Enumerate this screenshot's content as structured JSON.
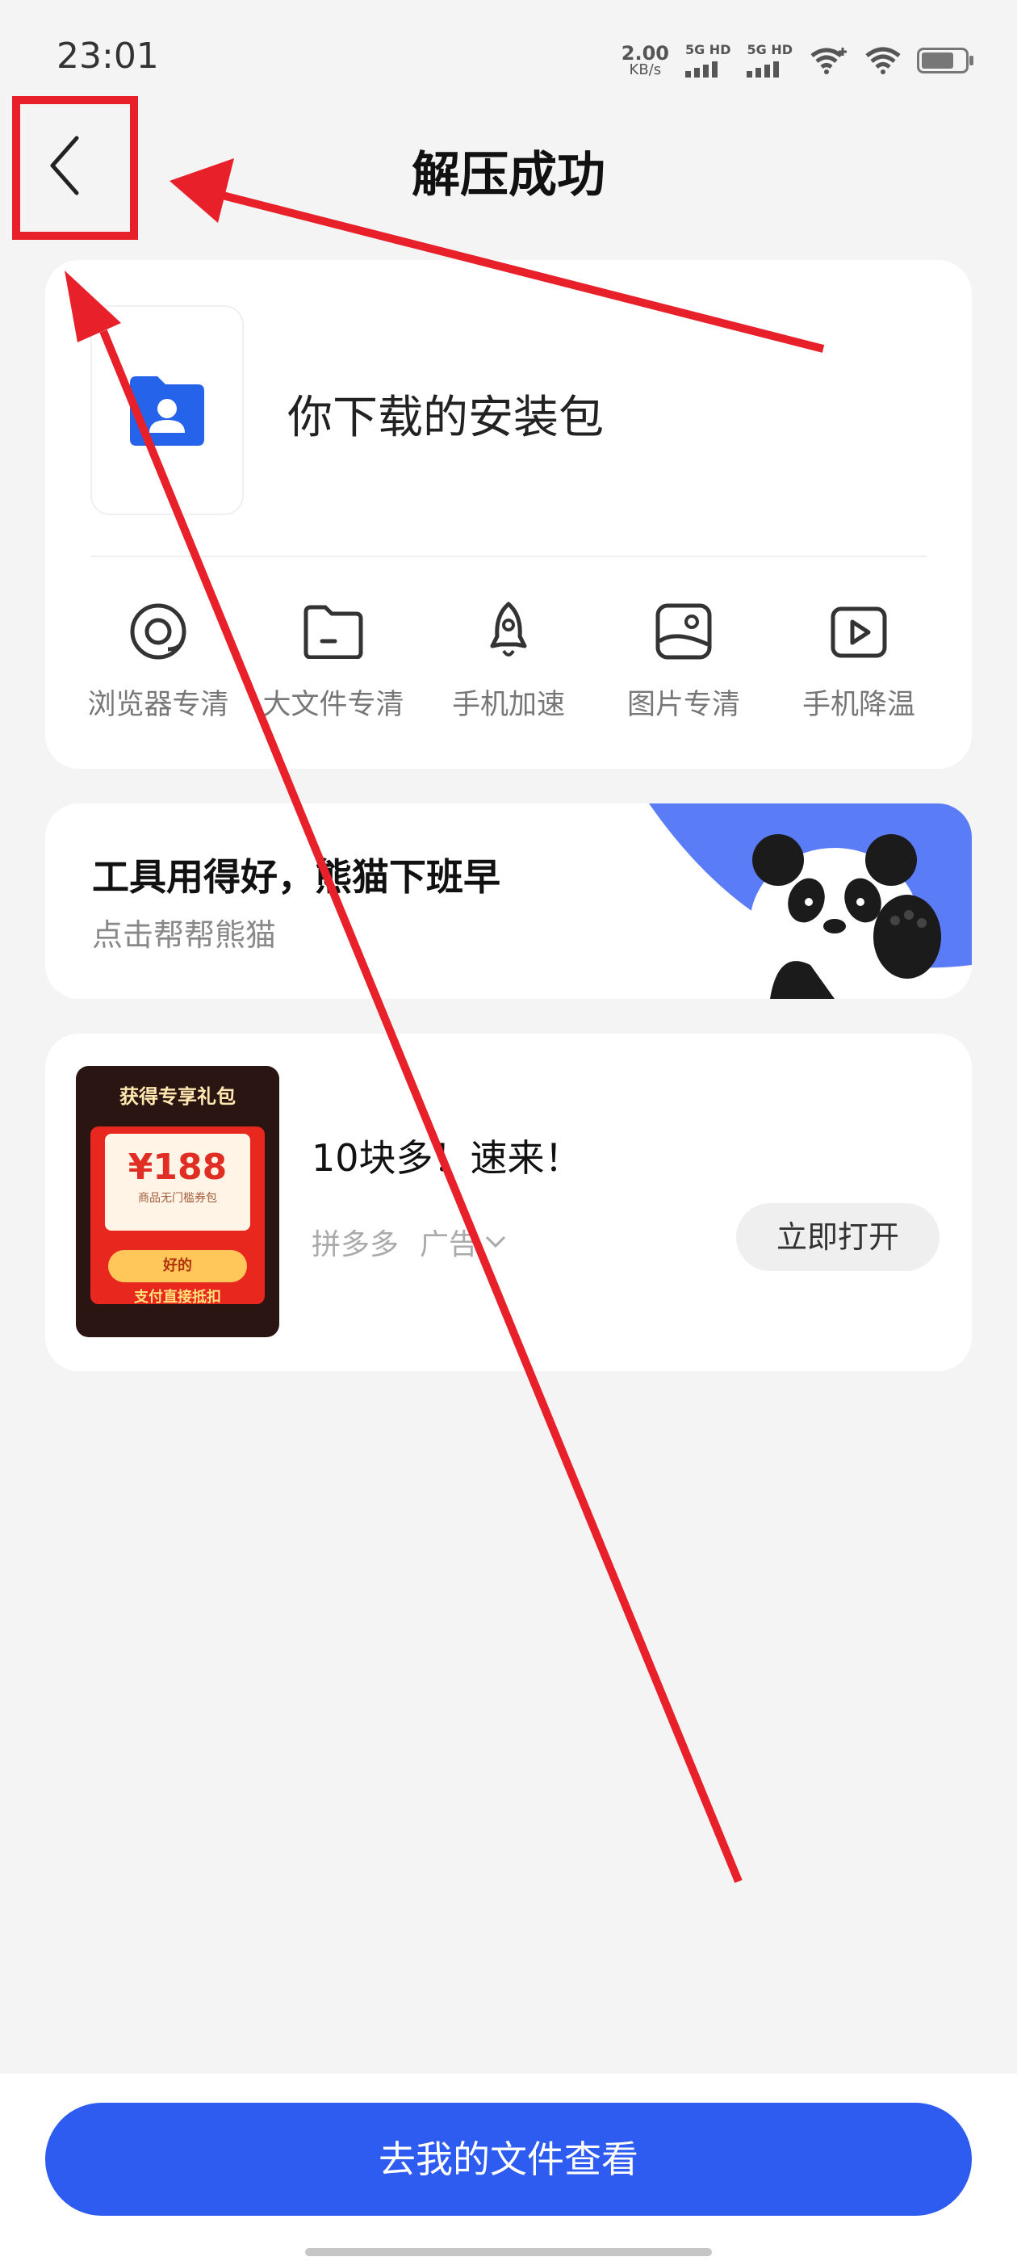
{
  "status_bar": {
    "time": "23:01",
    "net_speed_value": "2.00",
    "net_speed_unit": "KB/s",
    "sim1_label": "5G HD",
    "sim2_label": "5G HD",
    "battery_level": 0.75
  },
  "header": {
    "title": "解压成功",
    "back_icon": "chevron-left-icon"
  },
  "package": {
    "label": "你下载的安装包",
    "icon": "folder-user-icon",
    "icon_color": "#2563eb"
  },
  "tools": [
    {
      "label": "浏览器专清",
      "icon": "browser-icon"
    },
    {
      "label": "大文件专清",
      "icon": "folder-icon"
    },
    {
      "label": "手机加速",
      "icon": "rocket-icon"
    },
    {
      "label": "图片专清",
      "icon": "image-icon"
    },
    {
      "label": "手机降温",
      "icon": "play-icon"
    }
  ],
  "promo": {
    "title": "工具用得好，熊猫下班早",
    "subtitle": "点击帮帮熊猫",
    "accent": "#5b7cf7"
  },
  "ad": {
    "thumb_title": "获得专享礼包",
    "thumb_price": "¥188",
    "thumb_note": "商品无门槛券包",
    "thumb_ok": "好的",
    "thumb_pay": "支付直接抵扣",
    "title": "10块多！速来！",
    "source": "拼多多",
    "tag": "广告",
    "button": "立即打开"
  },
  "bottom": {
    "button": "去我的文件查看",
    "color": "#2e5cf0"
  },
  "annotation": {
    "color": "#e8202a"
  }
}
